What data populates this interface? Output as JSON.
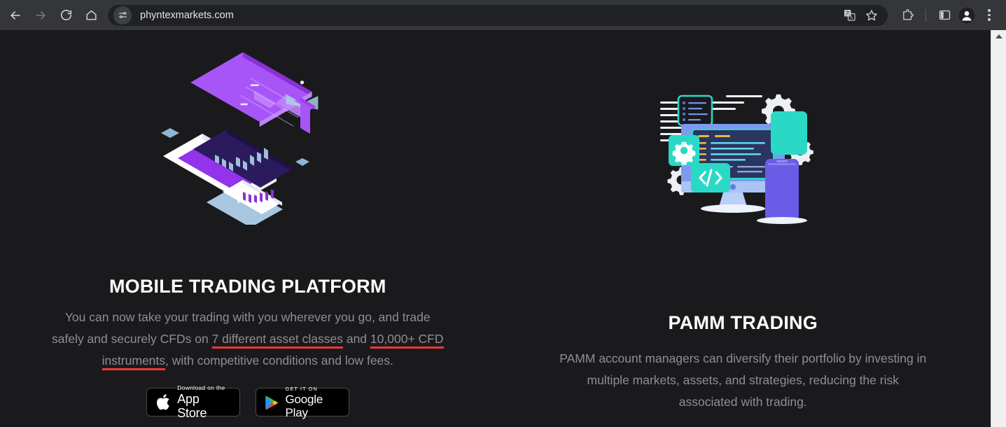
{
  "browser": {
    "back_label": "Back",
    "forward_label": "Forward",
    "reload_label": "Reload",
    "home_label": "Home",
    "url": "phyntexmarkets.com",
    "site_settings_icon": "tune-sliders-icon",
    "translate_icon": "translate-icon",
    "bookmark_icon": "star-icon",
    "extensions_icon": "puzzle-piece-icon",
    "side_panel_icon": "side-panel-icon",
    "profile_icon": "account-avatar-icon",
    "menu_icon": "three-dot-menu-icon",
    "toolbar_bg": "#35363a",
    "omnibox_bg": "#202124"
  },
  "page": {
    "background": "#1a1a1d",
    "heading_color": "#ffffff",
    "body_color": "#8d8f91",
    "accent_underline": "#f0383c"
  },
  "mobile_section": {
    "illustration_name": "isometric-mobile-trading-illustration",
    "heading": "MOBILE TRADING PLATFORM",
    "body_part1": "You can now take your trading with you wherever you go, and trade safely and securely CFDs on ",
    "link1": "7 different asset classes",
    "body_part2": " and ",
    "link2": "10,000+ CFD instruments",
    "body_part3": ", with competitive conditions and low fees.",
    "badges": {
      "apple": {
        "small": "Download on the",
        "big": "App Store",
        "icon": "apple-logo-icon"
      },
      "google": {
        "small": "GET IT ON",
        "big": "Google Play",
        "icon": "google-play-triangle-icon"
      }
    }
  },
  "pamm_section": {
    "illustration_name": "pamm-development-workstation-illustration",
    "heading": "PAMM TRADING",
    "body": "PAMM account managers can diversify their portfolio by investing in multiple markets, assets, and strategies, reducing the risk associated with trading."
  },
  "scrollbar": {
    "up_arrow_icon": "scroll-up-arrow-icon"
  }
}
